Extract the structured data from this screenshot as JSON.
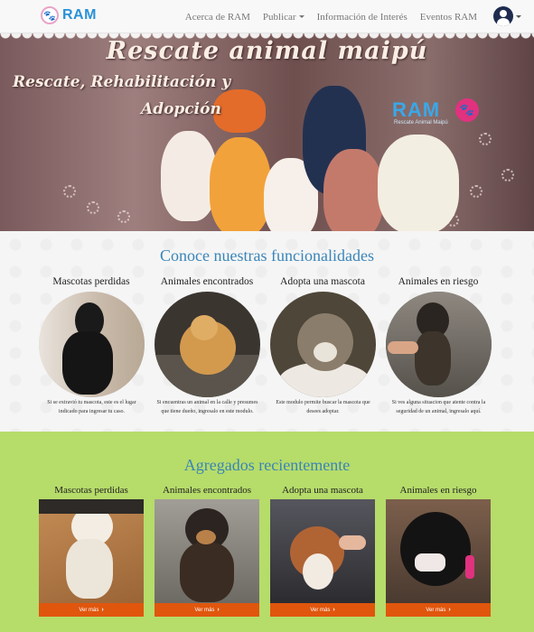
{
  "brand": {
    "name": "RAM"
  },
  "nav": {
    "items": [
      {
        "label": "Acerca de RAM"
      },
      {
        "label": "Publicar"
      },
      {
        "label": "Información de Interés"
      },
      {
        "label": "Eventos RAM"
      }
    ]
  },
  "hero": {
    "title": "Rescate animal maipú",
    "subtitle_line1": "Rescate, Rehabilitación y",
    "subtitle_line2": "Adopción",
    "logo_text": "RAM",
    "logo_subtext": "Rescate Animal Maipú"
  },
  "features": {
    "title": "Conoce nuestras funcionalidades",
    "cards": [
      {
        "title": "Mascotas perdidas",
        "description": "Si se extravió tu mascota, este es el lugar indicado para ingresar tu caso."
      },
      {
        "title": "Animales encontrados",
        "description": "Si encuentras un animal en la calle y presumes que tiene dueño, ingresalo en este modulo."
      },
      {
        "title": "Adopta una mascota",
        "description": "Este modulo permite buscar la mascota que desees adoptar."
      },
      {
        "title": "Animales en riesgo",
        "description": "Si ves alguna situacion que atente contra la seguridad de un animal, ingresalo aquí."
      }
    ]
  },
  "recent": {
    "title": "Agregados recientemente",
    "cards": [
      {
        "title": "Mascotas perdidas",
        "button": "Ver más"
      },
      {
        "title": "Animales encontrados",
        "button": "Ver más"
      },
      {
        "title": "Adopta una mascota",
        "button": "Ver más"
      },
      {
        "title": "Animales en riesgo",
        "button": "Ver más"
      }
    ]
  },
  "colors": {
    "brand_blue": "#2a92d6",
    "section_title_blue": "#3a85b8",
    "recent_bg": "#b6dc6a",
    "button_orange": "#e0560d"
  },
  "icons": {
    "paw": "paw-icon",
    "user": "user-icon",
    "caret": "caret-down-icon",
    "chevron": "chevron-right-icon"
  }
}
